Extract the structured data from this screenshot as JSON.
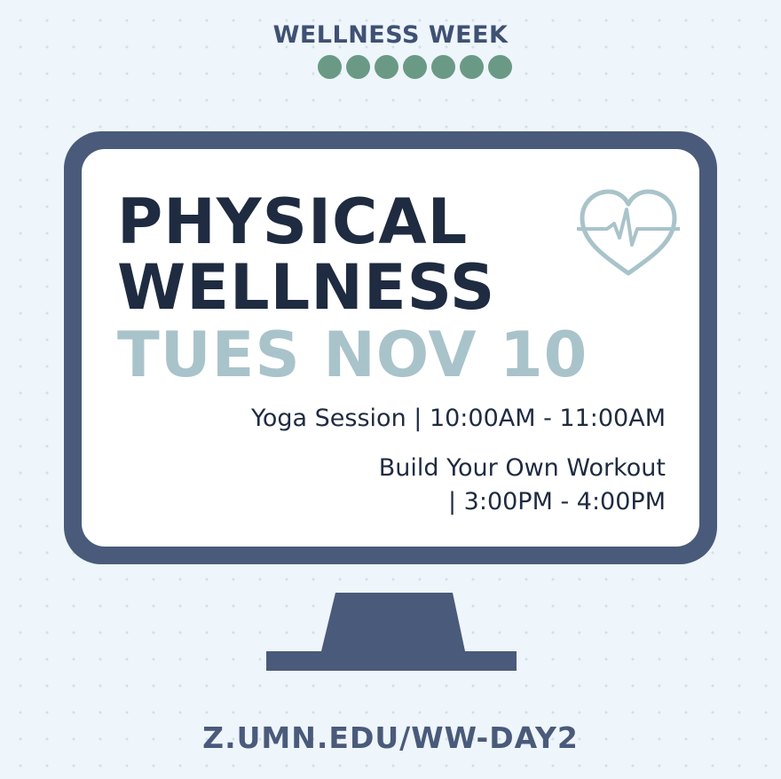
{
  "header": {
    "title": "WELLNESS WEEK",
    "icons": [
      "pill-icon",
      "stethoscope-icon",
      "flask-icon",
      "pills-icon",
      "microscope-icon",
      "microscope-alt-icon",
      "first-aid-kit-icon"
    ]
  },
  "main": {
    "title_line1": "PHYSICAL",
    "title_line2": "WELLNESS",
    "date": "TUES NOV 10",
    "events": [
      {
        "text": "Yoga Session | 10:00AM - 11:00AM"
      },
      {
        "text_line1": "Build Your Own Workout",
        "text_line2": "| 3:00PM - 4:00PM"
      }
    ]
  },
  "footer": {
    "url": "Z.UMN.EDU/WW-DAY2"
  },
  "colors": {
    "navy": "#4a5a7a",
    "dark_text": "#1f2b40",
    "pale_blue": "#a9c3ca",
    "green_icon": "#6a9a85",
    "background": "#eef5fb"
  }
}
